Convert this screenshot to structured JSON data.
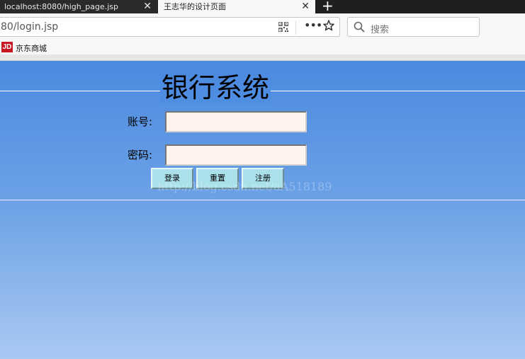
{
  "browser": {
    "tabs": [
      {
        "title": "localhost:8080/high_page.jsp",
        "active": false
      },
      {
        "title": "王志华的设计页面",
        "active": true
      }
    ],
    "close_glyph": "✕",
    "new_tab_glyph": "+",
    "url": "80/login.jsp",
    "more_glyph": "•••",
    "search_placeholder": "搜索",
    "bookmarks": [
      {
        "icon": "JD",
        "label": "京东商城"
      }
    ]
  },
  "page": {
    "title": "银行系统",
    "account_label": "账号:",
    "password_label": "密码:",
    "buttons": {
      "login": "登录",
      "reset": "重置",
      "register": "注册"
    },
    "watermark": "http://blog.csdn.net/aA518189",
    "colors": {
      "gradient_top": "#4a8ae0",
      "gradient_bottom": "#a9c9f2",
      "input_bg": "#fff3ee",
      "button_bg": "#a9e0ea"
    }
  }
}
